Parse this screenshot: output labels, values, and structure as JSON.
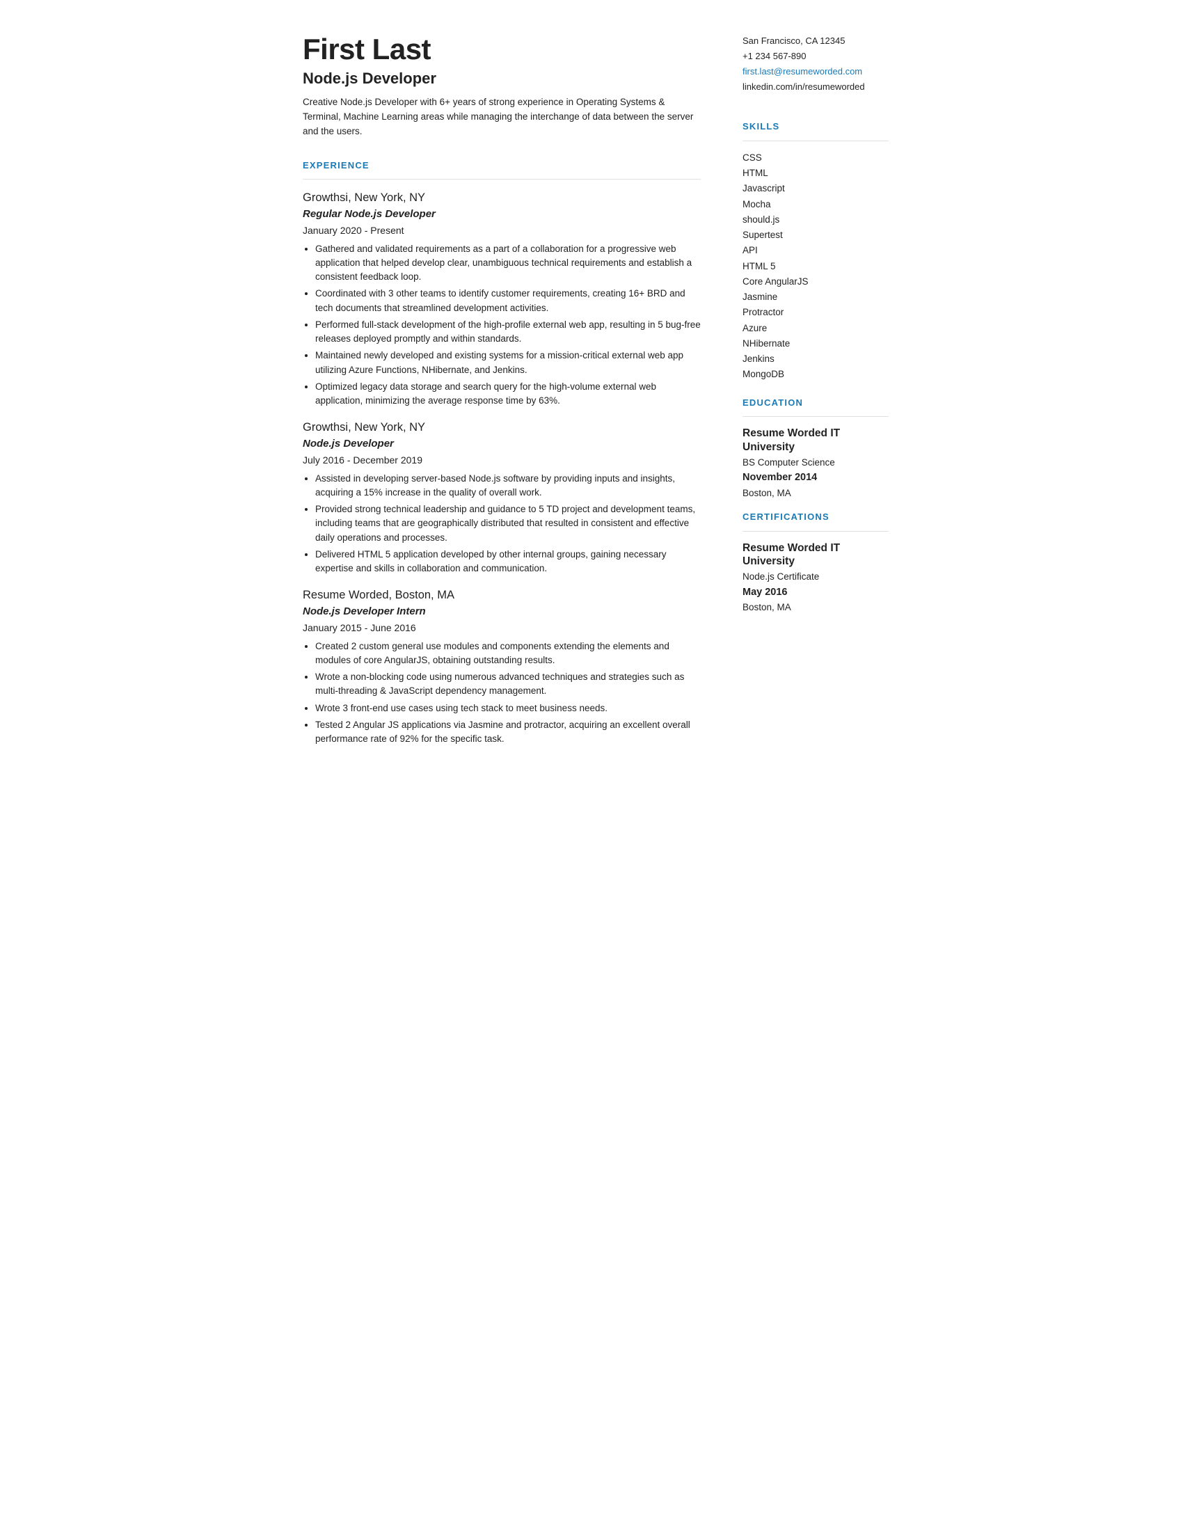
{
  "header": {
    "name": "First Last",
    "title": "Node.js Developer",
    "summary": "Creative Node.js Developer with 6+ years of strong experience in Operating Systems & Terminal, Machine Learning areas while managing the interchange of data between the server and the users."
  },
  "contact": {
    "address": "San Francisco, CA 12345",
    "phone": "+1 234 567-890",
    "email": "first.last@resumeworded.com",
    "linkedin": "linkedin.com/in/resumeworded"
  },
  "sections": {
    "experience_label": "EXPERIENCE",
    "skills_label": "SKILLS",
    "education_label": "EDUCATION",
    "certifications_label": "CERTIFICATIONS"
  },
  "experience": [
    {
      "company": "Growthsi,",
      "company_rest": " New York, NY",
      "role": "Regular Node.js Developer",
      "dates": "January 2020 - Present",
      "bullets": [
        "Gathered and validated requirements as a part of a collaboration for a progressive web application that helped develop clear, unambiguous technical requirements and establish a consistent feedback loop.",
        "Coordinated with 3 other teams to identify customer requirements, creating 16+ BRD and tech documents that streamlined development activities.",
        "Performed full-stack development of the high-profile external web app, resulting in 5 bug-free releases deployed promptly and within standards.",
        "Maintained newly developed and existing systems for a mission-critical external web app utilizing Azure Functions, NHibernate, and Jenkins.",
        "Optimized legacy data storage and search query for the high-volume external web application, minimizing the average response time by 63%."
      ]
    },
    {
      "company": "Growthsi,",
      "company_rest": " New York, NY",
      "role": "Node.js Developer",
      "dates": "July 2016 - December 2019",
      "bullets": [
        "Assisted in developing server-based Node.js software by providing inputs and insights, acquiring a 15% increase in the quality of overall work.",
        "Provided strong technical leadership and guidance to 5 TD project and development teams, including teams that are geographically distributed that resulted in consistent and effective daily operations and processes.",
        "Delivered HTML 5 application developed by other internal groups, gaining necessary expertise and skills in collaboration and communication."
      ]
    },
    {
      "company": "Resume Worded,",
      "company_rest": " Boston, MA",
      "role": "Node.js Developer Intern",
      "dates": "January 2015 - June 2016",
      "bullets": [
        "Created 2 custom general use modules and components extending the elements and modules of core AngularJS, obtaining outstanding results.",
        "Wrote a non-blocking code using numerous advanced techniques and strategies such as multi-threading & JavaScript dependency management.",
        "Wrote 3 front-end use cases using tech stack to meet business needs.",
        "Tested 2 Angular JS applications via Jasmine and protractor, acquiring an excellent overall performance rate of 92% for the specific task."
      ]
    }
  ],
  "skills": [
    "CSS",
    "HTML",
    "Javascript",
    "Mocha",
    "should.js",
    "Supertest",
    "API",
    "HTML 5",
    "Core AngularJS",
    "Jasmine",
    "Protractor",
    "Azure",
    "NHibernate",
    "Jenkins",
    "MongoDB"
  ],
  "education": [
    {
      "org": "Resume Worded IT University",
      "degree": "BS Computer Science",
      "date": "November 2014",
      "location": "Boston, MA"
    }
  ],
  "certifications": [
    {
      "org": "Resume Worded IT University",
      "degree": "Node.js Certificate",
      "date": "May 2016",
      "location": "Boston, MA"
    }
  ]
}
